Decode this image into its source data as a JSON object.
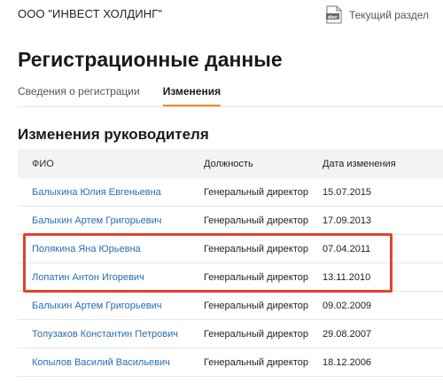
{
  "header": {
    "company": "ООО \"ИНВЕСТ ХОЛДИНГ\"",
    "doc_icon_text": "doc",
    "current_section": "Текущий раздел"
  },
  "page": {
    "title": "Регистрационные данные",
    "tabs": [
      {
        "label": "Сведения о регистрации",
        "active": false
      },
      {
        "label": "Изменения",
        "active": true
      }
    ],
    "section_title": "Изменения руководителя"
  },
  "table": {
    "headers": [
      "ФИО",
      "Должность",
      "Дата изменения"
    ],
    "rows": [
      {
        "name": "Балыхина Юлия Евгеньевна",
        "position": "Генеральный директор",
        "date": "15.07.2015"
      },
      {
        "name": "Балыхин Артем Григорьевич",
        "position": "Генеральный директор",
        "date": "17.09.2013"
      },
      {
        "name": "Полякина Яна Юрьевна",
        "position": "Генеральный директор",
        "date": "07.04.2011"
      },
      {
        "name": "Лопатин Антон Игоревич",
        "position": "Генеральный директор",
        "date": "13.11.2010"
      },
      {
        "name": "Балыхин Артем Григорьевич",
        "position": "Генеральный директор",
        "date": "09.02.2009"
      },
      {
        "name": "Толузаков Константин Петрович",
        "position": "Генеральный директор",
        "date": "29.08.2007"
      },
      {
        "name": "Копылов Василий Васильевич",
        "position": "Генеральный директор",
        "date": "18.12.2006"
      }
    ]
  },
  "colors": {
    "accent": "#f08a24",
    "link": "#2b6cb0",
    "highlight_border": "#e0452a",
    "header_bg": "#f3f3f3"
  }
}
